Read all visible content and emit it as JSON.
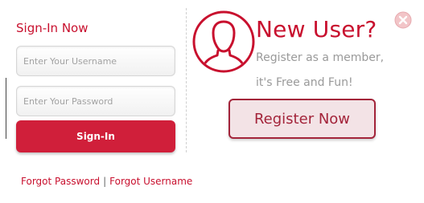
{
  "signin": {
    "title": "Sign-In Now",
    "username_placeholder": "Enter Your Username",
    "username_value": "",
    "password_placeholder": "Enter Your Password",
    "password_value": "",
    "button_label": "Sign-In"
  },
  "forgot": {
    "password_label": "Forgot Password",
    "separator": "|",
    "username_label": "Forgot Username"
  },
  "new_user": {
    "title": "New User?",
    "line1": "Register as a member,",
    "line2": "it's Free and Fun!",
    "register_button_label": "Register Now",
    "avatar_icon": "user-profile-icon",
    "close_icon": "close-icon"
  },
  "colors": {
    "accent_red": "#c8102e",
    "signin_button_bg": "#d01f3a",
    "register_border": "#a3243a",
    "register_bg": "#f3e3e6",
    "muted_text": "#9a9a9a",
    "close_icon_fill": "#f2c5c8"
  }
}
